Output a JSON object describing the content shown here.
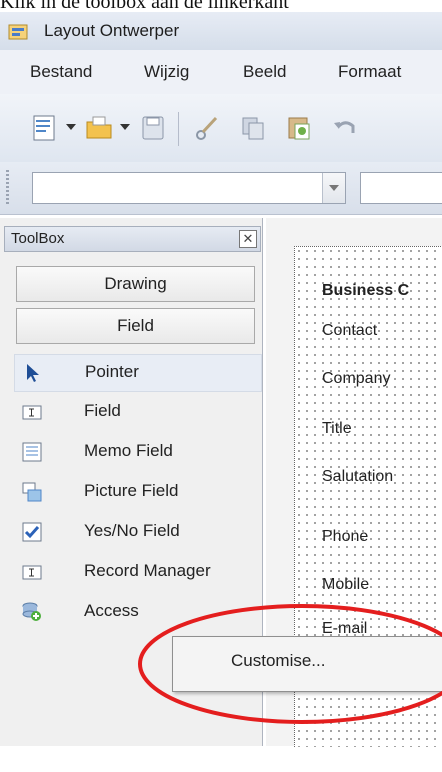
{
  "caption": "Klik in de toolbox aan de linkerkant",
  "window": {
    "title": "Layout Ontwerper"
  },
  "menu": [
    "Bestand",
    "Wijzig",
    "Beeld",
    "Formaat"
  ],
  "toolbox": {
    "title": "ToolBox",
    "close_glyph": "✕",
    "groups": [
      "Drawing",
      "Field"
    ],
    "tools": [
      "Pointer",
      "Field",
      "Memo Field",
      "Picture Field",
      "Yes/No Field",
      "Record Manager",
      "Access"
    ]
  },
  "canvas": {
    "heading": "Business C",
    "fields": [
      "Contact",
      "Company",
      "Title",
      "Salutation",
      "Phone",
      "Mobile",
      "E-mail"
    ]
  },
  "context_menu": {
    "item": "Customise..."
  },
  "colors": {
    "annotation": "#e41e1e",
    "accent": "#2c62b8"
  },
  "icons": [
    "new-document-icon",
    "open-folder-icon",
    "save-icon",
    "cut-icon",
    "copy-icon",
    "paste-icon",
    "undo-icon"
  ]
}
